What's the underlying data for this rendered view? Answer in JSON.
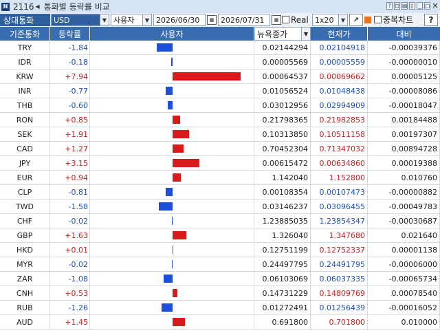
{
  "window": {
    "badge": "N",
    "screen_no": "2116",
    "title": "통화별 등락률 비교"
  },
  "toolbar": {
    "base_label": "상대통화",
    "base_currency": "USD",
    "mode": "사용자",
    "start_date": "2026/06/30",
    "end_date": "2026/07/31",
    "real_label": "Real",
    "interval": "1x20",
    "overlap_label": "중복차트",
    "help_label": "?"
  },
  "columns": {
    "currency": "기준통화",
    "change": "등락률",
    "bar": "사용자",
    "prev_close": "뉴욕종가",
    "current": "현재가",
    "diff": "대비"
  },
  "colors": {
    "up": "#d81c1c",
    "down": "#1f4fd8",
    "up_text": "#c81e1e",
    "down_text": "#1f4fb8"
  },
  "rows": [
    {
      "cur": "TRY",
      "chg": "-1.84",
      "chg_val": -1.84,
      "prev": "0.02144294",
      "now": "0.02104918",
      "diff": "-0.00039376"
    },
    {
      "cur": "IDR",
      "chg": "-0.18",
      "chg_val": -0.18,
      "prev": "0.00005569",
      "now": "0.00005559",
      "diff": "-0.00000010"
    },
    {
      "cur": "KRW",
      "chg": "+7.94",
      "chg_val": 7.94,
      "prev": "0.00064537",
      "now": "0.00069662",
      "diff": "0.00005125"
    },
    {
      "cur": "INR",
      "chg": "-0.77",
      "chg_val": -0.77,
      "prev": "0.01056524",
      "now": "0.01048438",
      "diff": "-0.00008086"
    },
    {
      "cur": "THB",
      "chg": "-0.60",
      "chg_val": -0.6,
      "prev": "0.03012956",
      "now": "0.02994909",
      "diff": "-0.00018047"
    },
    {
      "cur": "RON",
      "chg": "+0.85",
      "chg_val": 0.85,
      "prev": "0.21798365",
      "now": "0.21982853",
      "diff": "0.00184488"
    },
    {
      "cur": "SEK",
      "chg": "+1.91",
      "chg_val": 1.91,
      "prev": "0.10313850",
      "now": "0.10511158",
      "diff": "0.00197307"
    },
    {
      "cur": "CAD",
      "chg": "+1.27",
      "chg_val": 1.27,
      "prev": "0.70452304",
      "now": "0.71347032",
      "diff": "0.00894728"
    },
    {
      "cur": "JPY",
      "chg": "+3.15",
      "chg_val": 3.15,
      "prev": "0.00615472",
      "now": "0.00634860",
      "diff": "0.00019388"
    },
    {
      "cur": "EUR",
      "chg": "+0.94",
      "chg_val": 0.94,
      "prev": "1.142040",
      "now": "1.152800",
      "diff": "0.010760"
    },
    {
      "cur": "CLP",
      "chg": "-0.81",
      "chg_val": -0.81,
      "prev": "0.00108354",
      "now": "0.00107473",
      "diff": "-0.00000882"
    },
    {
      "cur": "TWD",
      "chg": "-1.58",
      "chg_val": -1.58,
      "prev": "0.03146237",
      "now": "0.03096455",
      "diff": "-0.00049783"
    },
    {
      "cur": "CHF",
      "chg": "-0.02",
      "chg_val": -0.02,
      "prev": "1.23885035",
      "now": "1.23854347",
      "diff": "-0.00030687"
    },
    {
      "cur": "GBP",
      "chg": "+1.63",
      "chg_val": 1.63,
      "prev": "1.326040",
      "now": "1.347680",
      "diff": "0.021640"
    },
    {
      "cur": "HKD",
      "chg": "+0.01",
      "chg_val": 0.01,
      "prev": "0.12751199",
      "now": "0.12752337",
      "diff": "0.00001138"
    },
    {
      "cur": "MYR",
      "chg": "-0.02",
      "chg_val": -0.02,
      "prev": "0.24497795",
      "now": "0.24491795",
      "diff": "-0.00006000"
    },
    {
      "cur": "ZAR",
      "chg": "-1.08",
      "chg_val": -1.08,
      "prev": "0.06103069",
      "now": "0.06037335",
      "diff": "-0.00065734"
    },
    {
      "cur": "CNH",
      "chg": "+0.53",
      "chg_val": 0.53,
      "prev": "0.14731229",
      "now": "0.14809769",
      "diff": "0.00078540"
    },
    {
      "cur": "RUB",
      "chg": "-1.26",
      "chg_val": -1.26,
      "prev": "0.01272491",
      "now": "0.01256439",
      "diff": "-0.00016052"
    },
    {
      "cur": "AUD",
      "chg": "+1.45",
      "chg_val": 1.45,
      "prev": "0.691800",
      "now": "0.701800",
      "diff": "0.010000"
    }
  ]
}
